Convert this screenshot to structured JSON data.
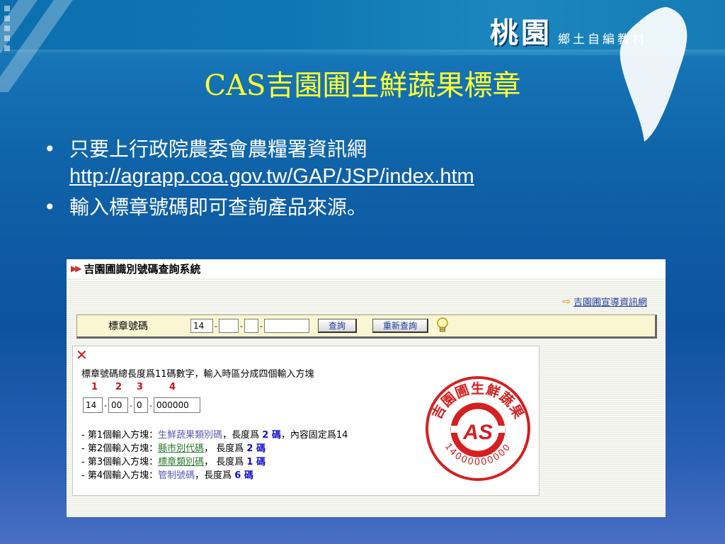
{
  "brand": {
    "big": "桃園",
    "small": "鄉土自編教材"
  },
  "slide": {
    "title": "CAS吉園圃生鮮蔬果標章",
    "bullets": [
      {
        "text": "只要上行政院農委會農糧署資訊網",
        "link": "http://agrapp.coa.gov.tw/GAP/JSP/index.htm"
      },
      {
        "text": "輸入標章號碼即可查詢產品來源。"
      }
    ],
    "bullet_glyph": "•"
  },
  "screenshot": {
    "header_title": "吉園圃識別號碼查詢系統",
    "header_arrows": "▶▶",
    "promo_link": "吉園圃宣導資訊網",
    "query": {
      "label": "標章號碼",
      "segments": [
        "14",
        "",
        "",
        ""
      ],
      "dash": "-",
      "search_button": "查詢",
      "reset_button": "重新查詢"
    },
    "help": {
      "close": "✕",
      "line1": "標章號碼總長度爲11碼數字，輸入時區分成四個輸入方塊",
      "numbers": [
        "1",
        "2",
        "3",
        "4"
      ],
      "sample": [
        "14",
        "00",
        "0",
        "000000"
      ],
      "items": [
        {
          "prefix": "- 第1個輸入方塊：",
          "name": "生鮮蔬果類別碼",
          "mid": "，長度爲 ",
          "len": "2 碼",
          "tail": "，內容固定爲14"
        },
        {
          "prefix": "- 第2個輸入方塊：",
          "name": "縣市別代碼",
          "mid": "， 長度爲 ",
          "len": "2 碼",
          "tail": ""
        },
        {
          "prefix": "- 第3個輸入方塊：",
          "name": "標章類別碼",
          "mid": "， 長度爲 ",
          "len": "1 碼",
          "tail": ""
        },
        {
          "prefix": "- 第4個輸入方塊：",
          "name": "管制號碼",
          "mid": "，長度爲 ",
          "len": "6 碼",
          "tail": ""
        }
      ],
      "seal_text": "吉園圃生鮮蔬果",
      "seal_logo": "AS",
      "seal_number": "14000000000"
    }
  },
  "colors": {
    "title": "#ffff33",
    "seal_red": "#d42020",
    "link_blue": "#1a3a9c"
  }
}
